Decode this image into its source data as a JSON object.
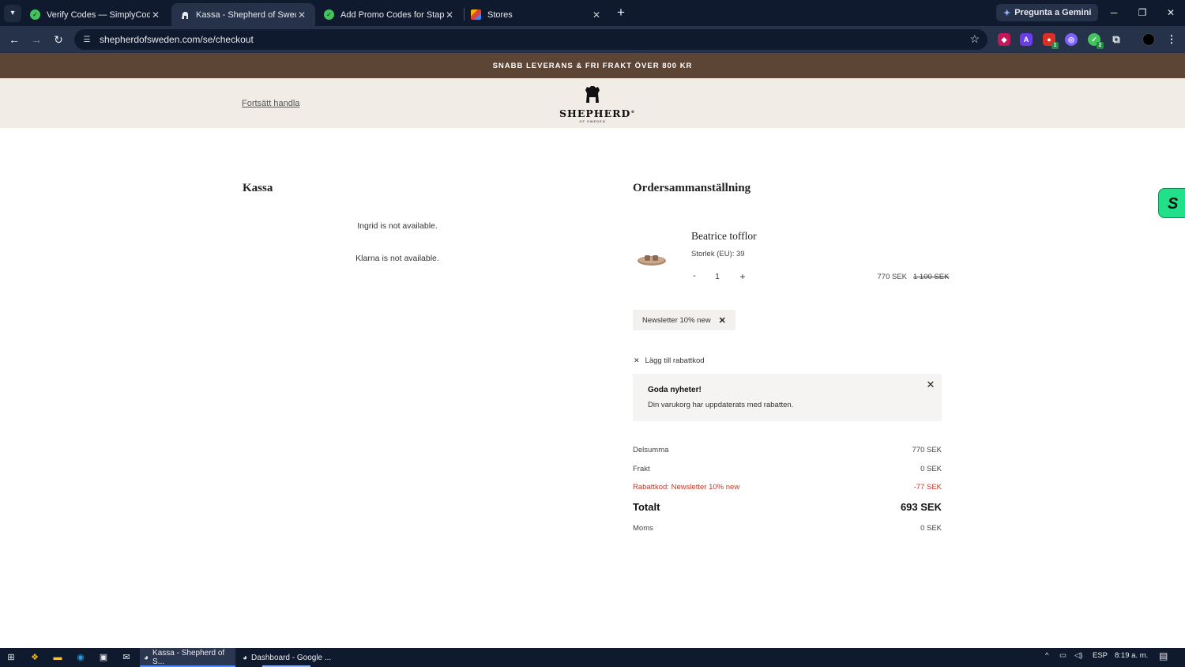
{
  "browser": {
    "tabs": [
      {
        "title": "Verify Codes — SimplyCodes"
      },
      {
        "title": "Kassa - Shepherd of Sweden"
      },
      {
        "title": "Add Promo Codes for Staples -"
      },
      {
        "title": "Stores"
      }
    ],
    "gemini_label": "Pregunta a Gemini",
    "url": "shepherdofsweden.com/se/checkout"
  },
  "site": {
    "banner": "SNABB LEVERANS & FRI FRAKT ÖVER 800 KR",
    "continue_link": "Fortsätt handla",
    "logo_text": "SHEPHERD",
    "logo_reg": "®",
    "logo_sub": "OF SWEDEN"
  },
  "checkout": {
    "heading": "Kassa",
    "unavailable": [
      "Ingrid is not available.",
      "Klarna is not available."
    ]
  },
  "summary": {
    "heading": "Ordersammanställning",
    "product": {
      "name": "Beatrice tofflor",
      "size": "Storlek (EU): 39",
      "qty_minus": "-",
      "qty": "1",
      "qty_plus": "+",
      "price": "770 SEK",
      "price_old": "1 100 SEK"
    },
    "coupon_chip": "Newsletter 10% new",
    "add_code": "Lägg till rabattkod",
    "notice": {
      "title": "Goda nyheter!",
      "body": "Din varukorg har uppdaterats med rabatten."
    },
    "rows": {
      "subtotal_label": "Delsumma",
      "subtotal_value": "770 SEK",
      "shipping_label": "Frakt",
      "shipping_value": "0 SEK",
      "discount_label": "Rabattkod: Newsletter 10% new",
      "discount_value": "-77 SEK",
      "total_label": "Totalt",
      "total_value": "693 SEK",
      "vat_label": "Moms",
      "vat_value": "0 SEK"
    }
  },
  "extension": {
    "badge_letter": "S"
  },
  "taskbar": {
    "apps": [
      {
        "label": "Kassa - Shepherd of S..."
      },
      {
        "label": "Dashboard - Google ..."
      }
    ],
    "language": "ESP",
    "time": "8:19 a. m."
  },
  "colors": {
    "banner": "#5c4535",
    "header_bg": "#f1ede6",
    "discount": "#c0392b",
    "extension_badge": "#20e08a"
  }
}
